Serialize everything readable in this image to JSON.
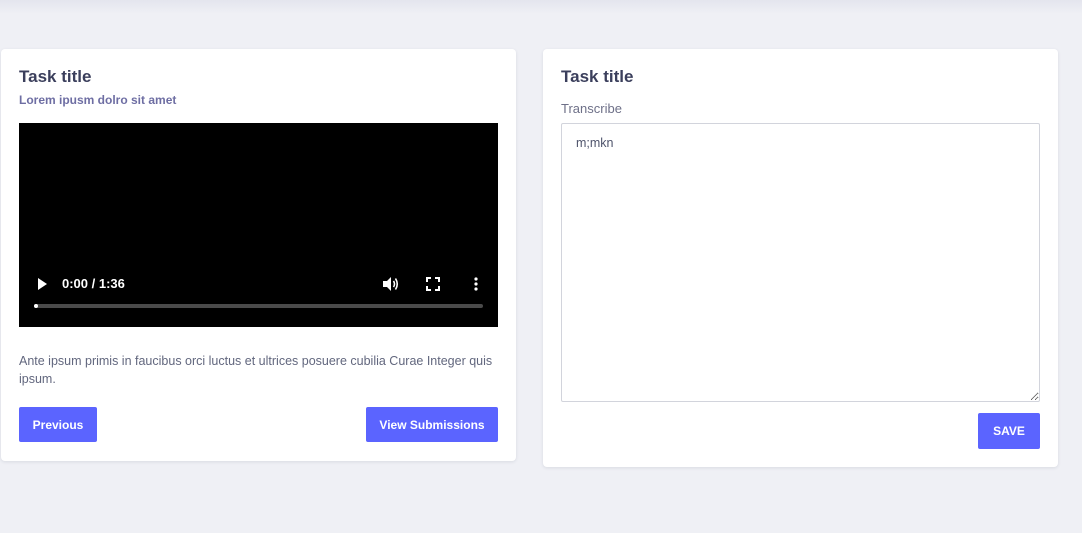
{
  "left_card": {
    "title": "Task title",
    "subtitle": "Lorem ipusm dolro sit amet",
    "video": {
      "time": "0:00 / 1:36",
      "progress": 0.0
    },
    "description": "Ante ipsum primis in faucibus orci luctus et ultrices posuere cubilia Curae Integer quis ipsum.",
    "previous_label": "Previous",
    "submissions_label": "View Submissions"
  },
  "right_card": {
    "title": "Task title",
    "field_label": "Transcribe",
    "field_value": "m;mkn",
    "save_label": "SAVE"
  },
  "colors": {
    "accent": "#5b64ff",
    "background": "#eff0f5",
    "title": "#3b3f5c"
  }
}
